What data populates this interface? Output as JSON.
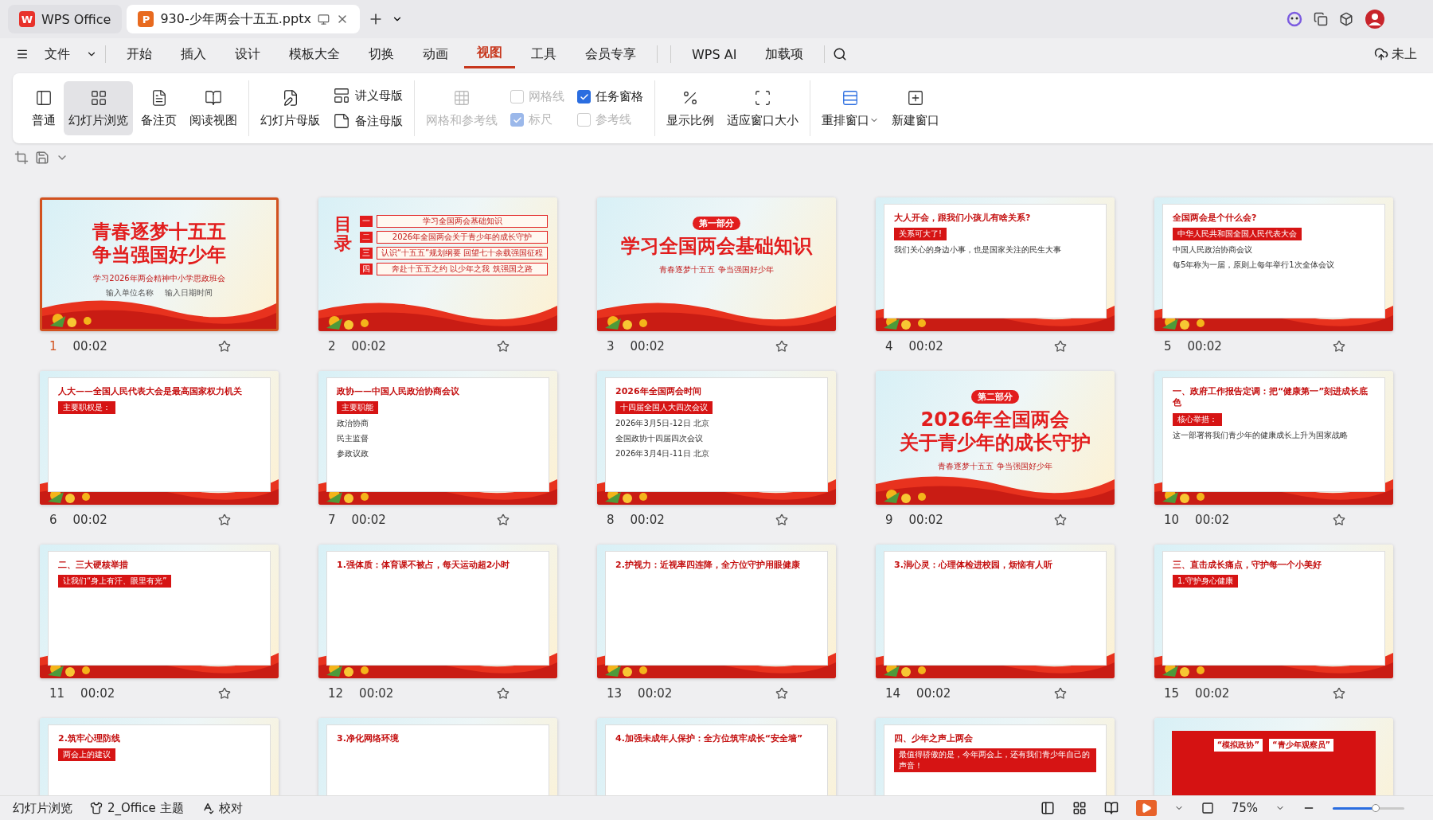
{
  "tabs": [
    {
      "label": "WPS Office",
      "logo": "W",
      "kind": "home",
      "selected": false
    },
    {
      "label": "930-少年两会十五五.pptx",
      "logo": "P",
      "kind": "doc",
      "selected": true
    }
  ],
  "menu": {
    "file": "文件",
    "items": [
      {
        "label": "开始",
        "selected": false
      },
      {
        "label": "插入",
        "selected": false
      },
      {
        "label": "设计",
        "selected": false
      },
      {
        "label": "模板大全",
        "selected": false
      },
      {
        "label": "切换",
        "selected": false
      },
      {
        "label": "动画",
        "selected": false
      },
      {
        "label": "视图",
        "selected": true
      },
      {
        "label": "工具",
        "selected": false
      },
      {
        "label": "会员专享",
        "selected": false
      },
      {
        "label": "WPS AI",
        "selected": false
      },
      {
        "label": "加载项",
        "selected": false
      }
    ],
    "upload": "未上"
  },
  "ribbon": {
    "views": [
      {
        "label": "普通",
        "selected": false
      },
      {
        "label": "幻灯片浏览",
        "selected": true
      },
      {
        "label": "备注页",
        "selected": false
      },
      {
        "label": "阅读视图",
        "selected": false
      }
    ],
    "master": {
      "label": "幻灯片母版",
      "small": [
        "讲义母版",
        "备注母版"
      ]
    },
    "grid": {
      "label": "网格和参考线",
      "disabled": true
    },
    "checks": [
      {
        "label": "网格线",
        "checked": false,
        "disabled": true
      },
      {
        "label": "任务窗格",
        "checked": true,
        "disabled": false
      },
      {
        "label": "标尺",
        "checked": true,
        "disabled": true
      },
      {
        "label": "参考线",
        "checked": false,
        "disabled": true
      }
    ],
    "zoom": [
      "显示比例",
      "适应窗口大小"
    ],
    "window": [
      {
        "label": "重排窗口",
        "dropdown": true
      },
      {
        "label": "新建窗口",
        "dropdown": false
      }
    ]
  },
  "slides": [
    {
      "num": "1",
      "time": "00:02",
      "kind": "cover",
      "selected": true,
      "titles": [
        "青春逐梦十五五",
        "争当强国好少年"
      ],
      "subtitle": "学习2026年两会精神中小学思政班会",
      "lines": [
        "输入单位名称",
        "输入日期时间"
      ]
    },
    {
      "num": "2",
      "time": "00:02",
      "kind": "toc",
      "selected": false,
      "titles": [
        "目录"
      ],
      "lines": [
        "学习全国两会基础知识",
        "2026年全国两会关于青少年的成长守护",
        "认识“十五五”规划纲要 回望七十余载强国征程",
        "奔赴十五五之约 以少年之我 筑强国之路"
      ],
      "marks": [
        "一",
        "二",
        "三",
        "四"
      ]
    },
    {
      "num": "3",
      "time": "00:02",
      "kind": "cover",
      "selected": false,
      "badge": "第一部分",
      "titles": [
        "学习全国两会基础知识"
      ],
      "subtitle": "青春逐梦十五五 争当强国好少年"
    },
    {
      "num": "4",
      "time": "00:02",
      "kind": "content",
      "selected": false,
      "titles": [
        "大人开会，跟我们小孩儿有啥关系?"
      ],
      "lines": [
        "关系可大了!",
        "我们关心的身边小事，也是国家关注的民生大事"
      ]
    },
    {
      "num": "5",
      "time": "00:02",
      "kind": "content",
      "selected": false,
      "titles": [
        "全国两会是个什么会?"
      ],
      "lines": [
        "中华人民共和国全国人民代表大会",
        "中国人民政治协商会议",
        "每5年称为一届，原则上每年举行1次全体会议"
      ]
    },
    {
      "num": "6",
      "time": "00:02",
      "kind": "content",
      "selected": false,
      "titles": [
        "人大——全国人民代表大会是最高国家权力机关"
      ],
      "lines": [
        "主要职权是："
      ]
    },
    {
      "num": "7",
      "time": "00:02",
      "kind": "content",
      "selected": false,
      "titles": [
        "政协——中国人民政治协商会议"
      ],
      "lines": [
        "主要职能",
        "政治协商",
        "民主监督",
        "参政议政"
      ]
    },
    {
      "num": "8",
      "time": "00:02",
      "kind": "content",
      "selected": false,
      "titles": [
        "2026年全国两会时间"
      ],
      "lines": [
        "十四届全国人大四次会议",
        "2026年3月5日-12日 北京",
        "全国政协十四届四次会议",
        "2026年3月4日-11日 北京"
      ]
    },
    {
      "num": "9",
      "time": "00:02",
      "kind": "cover",
      "selected": false,
      "badge": "第二部分",
      "titles": [
        "2026年全国两会",
        "关于青少年的成长守护"
      ],
      "subtitle": "青春逐梦十五五 争当强国好少年"
    },
    {
      "num": "10",
      "time": "00:02",
      "kind": "content",
      "selected": false,
      "titles": [
        "一、政府工作报告定调：把“健康第一”刻进成长底色"
      ],
      "lines": [
        "核心举措：",
        "这一部署将我们青少年的健康成长上升为国家战略"
      ]
    },
    {
      "num": "11",
      "time": "00:02",
      "kind": "content",
      "selected": false,
      "titles": [
        "二、三大硬核举措"
      ],
      "lines": [
        "让我们“身上有汗、眼里有光”"
      ]
    },
    {
      "num": "12",
      "time": "00:02",
      "kind": "content",
      "selected": false,
      "titles": [
        "1.强体质：体育课不被占，每天运动超2小时"
      ]
    },
    {
      "num": "13",
      "time": "00:02",
      "kind": "content",
      "selected": false,
      "titles": [
        "2.护视力：近视率四连降，全方位守护用眼健康"
      ]
    },
    {
      "num": "14",
      "time": "00:02",
      "kind": "content",
      "selected": false,
      "titles": [
        "3.润心灵：心理体检进校园，烦恼有人听"
      ]
    },
    {
      "num": "15",
      "time": "00:02",
      "kind": "content",
      "selected": false,
      "titles": [
        "三、直击成长痛点，守护每一个小美好"
      ],
      "lines": [
        "1.守护身心健康"
      ]
    },
    {
      "kind": "content",
      "selected": false,
      "titles": [
        "2.筑牢心理防线"
      ],
      "lines": [
        "两会上的建议"
      ]
    },
    {
      "kind": "content",
      "selected": false,
      "titles": [
        "3.净化网络环境"
      ]
    },
    {
      "kind": "content",
      "selected": false,
      "titles": [
        "4.加强未成年人保护：全方位筑牢成长“安全墙”"
      ]
    },
    {
      "kind": "content",
      "selected": false,
      "titles": [
        "四、少年之声上两会"
      ],
      "lines": [
        "最值得骄傲的是，今年两会上，还有我们青少年自己的声音！"
      ]
    },
    {
      "kind": "banner",
      "selected": false,
      "titles": [
        "“模拟政协”",
        "“青少年观察员”"
      ]
    }
  ],
  "status": {
    "view": "幻灯片浏览",
    "theme": "2_Office 主题",
    "proof": "校对",
    "zoom": "75%",
    "level": 0.6
  }
}
